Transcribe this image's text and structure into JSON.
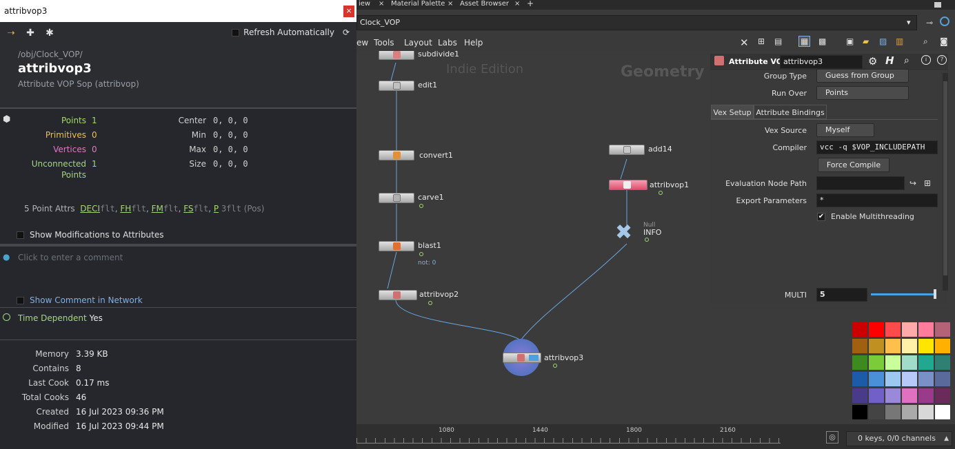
{
  "info_window": {
    "title": "attribvop3",
    "close": "×",
    "refresh_label": "Refresh Automatically",
    "path": "/obj/Clock_VOP/",
    "node_name": "attribvop3",
    "node_type": "Attribute VOP Sop (attribvop)",
    "geometry": {
      "points_label": "Points",
      "points_value": "1",
      "primitives_label": "Primitives",
      "primitives_value": "0",
      "vertices_label": "Vertices",
      "vertices_value": "0",
      "unconnected_label": "Unconnected",
      "unconnected_label2": "Points",
      "unconnected_value": "1",
      "center_label": "Center",
      "center_value": "0,  0,  0",
      "min_label": "Min",
      "min_value": "0,  0,  0",
      "max_label": "Max",
      "max_value": "0,  0,  0",
      "size_label": "Size",
      "size_value": "0,  0,  0"
    },
    "attrs": {
      "prefix": "5 Point Attrs",
      "items": [
        {
          "name": "DECI",
          "type": "flt"
        },
        {
          "name": "FH",
          "type": "flt"
        },
        {
          "name": "FM",
          "type": "flt"
        },
        {
          "name": "FS",
          "type": "flt"
        }
      ],
      "last_name": "P",
      "last_type": "3flt",
      "last_suffix": "(Pos)"
    },
    "show_mods": "Show Modifications to Attributes",
    "comment_placeholder": "Click to enter a comment",
    "show_comment": "Show Comment in Network",
    "time_dependent_label": "Time Dependent",
    "time_dependent_value": "Yes",
    "stats": [
      {
        "label": "Memory",
        "value": "3.39 KB"
      },
      {
        "label": "Contains",
        "value": "8"
      },
      {
        "label": "Last Cook",
        "value": "0.17 ms"
      },
      {
        "label": "Total Cooks",
        "value": "46"
      },
      {
        "label": "Created",
        "value": "16 Jul 2023 09:36 PM"
      },
      {
        "label": "Modified",
        "value": "16 Jul 2023 09:44 PM"
      }
    ]
  },
  "tabs": {
    "t0": "iew",
    "t1": "Material Palette",
    "t2": "Asset Browser",
    "close": "×",
    "add": "+"
  },
  "pathbar": {
    "path": "Clock_VOP"
  },
  "menu": {
    "m0": "ew",
    "m1": "Tools",
    "m2": "Layout",
    "m3": "Labs",
    "m4": "Help"
  },
  "network": {
    "watermark_left": "Indie Edition",
    "watermark_right": "Geometry",
    "nodes": {
      "subdivide1": "subdivide1",
      "edit1": "edit1",
      "convert1": "convert1",
      "carve1": "carve1",
      "blast1": "blast1",
      "blast_note": "not: 0",
      "attribvop2": "attribvop2",
      "attribvop3": "attribvop3",
      "add14": "add14",
      "attribvop1": "attribvop1",
      "null_type": "Null",
      "info": "INFO"
    }
  },
  "parm": {
    "node_type": "Attribute VOP",
    "node_name": "attribvop3",
    "group_type_label": "Group Type",
    "group_type_value": "Guess from Group",
    "run_over_label": "Run Over",
    "run_over_value": "Points",
    "tab_vex": "Vex Setup",
    "tab_bindings": "Attribute Bindings",
    "vex_source_label": "Vex Source",
    "vex_source_value": "Myself",
    "compiler_label": "Compiler",
    "compiler_value": "vcc -q $VOP_INCLUDEPATH",
    "force_compile": "Force Compile",
    "eval_path_label": "Evaluation Node Path",
    "export_label": "Export Parameters",
    "export_value": "*",
    "multithread_label": "Enable Multithreading",
    "multi_label": "MULTI",
    "multi_value": "5"
  },
  "timeline": {
    "t1": "1080",
    "t2": "1440",
    "t3": "1800",
    "t4": "2160",
    "keys": "0 keys, 0/0 channels"
  },
  "colors": {
    "accent_green": "#a5d67a",
    "accent_yellow": "#f0c04a",
    "accent_pink": "#d97bc6"
  }
}
